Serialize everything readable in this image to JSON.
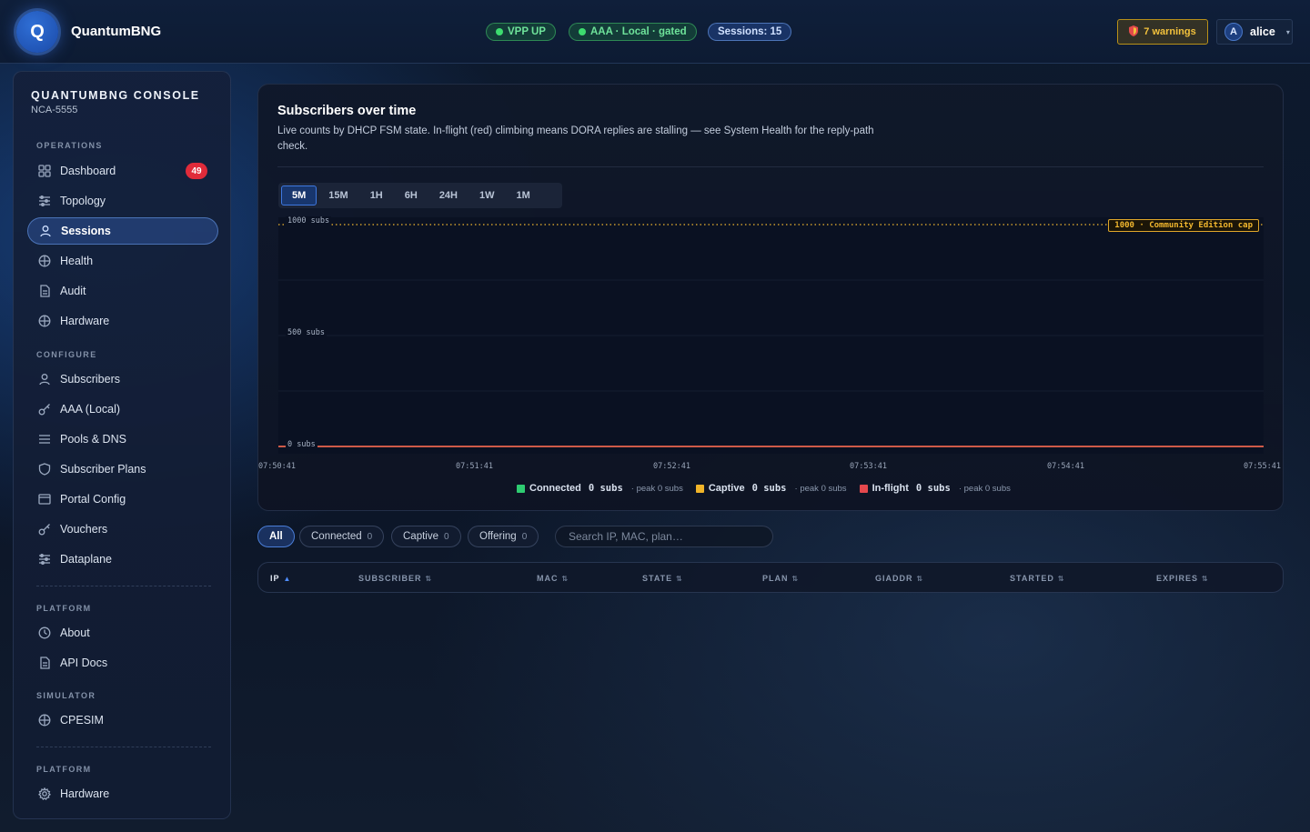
{
  "header": {
    "logo_letter": "Q",
    "brand": "QuantumBNG",
    "vpp": "VPP UP",
    "aaa": "AAA · Local · gated",
    "sessions": "Sessions: 15",
    "warnings": "7 warnings",
    "user_initial": "A",
    "user_name": "alice"
  },
  "sidebar": {
    "title": "QUANTUMBNG CONSOLE",
    "subtitle": "NCA-5555",
    "sections": {
      "operations": "OPERATIONS",
      "configure": "CONFIGURE",
      "platform": "PLATFORM",
      "simulator": "SIMULATOR",
      "platform2": "PLATFORM"
    },
    "items": [
      {
        "label": "Dashboard",
        "icon": "grid-icon",
        "badge": "49"
      },
      {
        "label": "Topology",
        "icon": "sliders-icon"
      },
      {
        "label": "Sessions",
        "icon": "user-icon",
        "active": true
      },
      {
        "label": "Health",
        "icon": "globe-icon"
      },
      {
        "label": "Audit",
        "icon": "document-icon"
      },
      {
        "label": "Hardware",
        "icon": "globe-icon"
      },
      {
        "label": "Subscribers",
        "icon": "user-icon"
      },
      {
        "label": "AAA (Local)",
        "icon": "key-icon"
      },
      {
        "label": "Pools & DNS",
        "icon": "list-icon"
      },
      {
        "label": "Subscriber Plans",
        "icon": "shield-icon"
      },
      {
        "label": "Portal Config",
        "icon": "window-icon"
      },
      {
        "label": "Vouchers",
        "icon": "key-icon"
      },
      {
        "label": "Dataplane",
        "icon": "sliders-icon"
      },
      {
        "label": "About",
        "icon": "clock-icon"
      },
      {
        "label": "API Docs",
        "icon": "document-icon"
      },
      {
        "label": "CPESIM",
        "icon": "globe-icon"
      },
      {
        "label": "Hardware",
        "icon": "gear-icon"
      }
    ]
  },
  "card": {
    "title": "Subscribers over time",
    "description": "Live counts by DHCP FSM state. In-flight (red) climbing means DORA replies are stalling — see System Health for the reply-path check.",
    "ranges": [
      "5M",
      "15M",
      "1H",
      "6H",
      "24H",
      "1W",
      "1M"
    ],
    "active_range": "5M"
  },
  "chart_data": {
    "type": "area",
    "x": [
      "07:50:41",
      "07:51:41",
      "07:52:41",
      "07:53:41",
      "07:54:41",
      "07:55:41"
    ],
    "ylim": [
      0,
      1000
    ],
    "yticks": [
      "1000 subs",
      "500 subs",
      "0 subs"
    ],
    "series": [
      {
        "name": "Connected",
        "value": "0 subs",
        "peak": "peak 0 subs",
        "color": "#2ecc71",
        "values": [
          0,
          0,
          0,
          0,
          0,
          0
        ]
      },
      {
        "name": "Captive",
        "value": "0 subs",
        "peak": "peak 0 subs",
        "color": "#f0b429",
        "values": [
          0,
          0,
          0,
          0,
          0,
          0
        ]
      },
      {
        "name": "In-flight",
        "value": "0 subs",
        "peak": "peak 0 subs",
        "color": "#e5484d",
        "values": [
          0,
          0,
          0,
          0,
          0,
          0
        ]
      }
    ],
    "cap": {
      "value": 1000,
      "label": "1000 · Community Edition cap",
      "color": "#f2b72e"
    }
  },
  "filters": [
    {
      "label": "All",
      "active": true
    },
    {
      "label": "Connected",
      "count": "0"
    },
    {
      "label": "Captive",
      "count": "0"
    },
    {
      "label": "Offering",
      "count": "0"
    }
  ],
  "search": {
    "placeholder": "Search IP, MAC, plan…"
  },
  "table": {
    "columns": [
      "IP",
      "SUBSCRIBER",
      "MAC",
      "STATE",
      "PLAN",
      "GIADDR",
      "STARTED",
      "EXPIRES"
    ],
    "sort_up": "▲",
    "sort_both": "⇅"
  },
  "colors": {
    "accent": "#3e78df",
    "badge": "#e02b3a",
    "warning": "#f2c13c"
  }
}
